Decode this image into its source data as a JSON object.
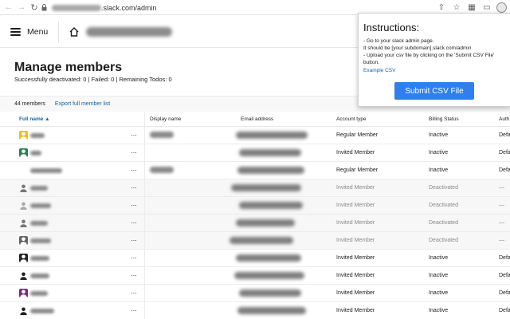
{
  "browser": {
    "url_visible_suffix": ".slack.com/admin"
  },
  "header": {
    "menu_label": "Menu"
  },
  "page": {
    "title": "Manage members",
    "stats": "Successfully deactivated: 0 | Failed: 0 | Remaining Todos: 0"
  },
  "members_bar": {
    "count": "44 members",
    "export_label": "Export full member list"
  },
  "table": {
    "headers": {
      "full_name": "Full name ▲",
      "display_name": "Display name",
      "email": "Email address",
      "account_type": "Account type",
      "billing": "Billing Status",
      "auth": "Auth"
    },
    "rows": [
      {
        "account_type": "Regular Member",
        "billing": "Inactive",
        "auth": "Defa",
        "deactivated": false
      },
      {
        "account_type": "Invited Member",
        "billing": "Inactive",
        "auth": "Defa",
        "deactivated": false
      },
      {
        "account_type": "Regular Member",
        "billing": "Inactive",
        "auth": "Defa",
        "deactivated": false
      },
      {
        "account_type": "Invited Member",
        "billing": "Deactivated",
        "auth": "—",
        "deactivated": true
      },
      {
        "account_type": "Invited Member",
        "billing": "Deactivated",
        "auth": "—",
        "deactivated": true
      },
      {
        "account_type": "Invited Member",
        "billing": "Deactivated",
        "auth": "—",
        "deactivated": true
      },
      {
        "account_type": "Invited Member",
        "billing": "Deactivated",
        "auth": "—",
        "deactivated": true
      },
      {
        "account_type": "Invited Member",
        "billing": "Inactive",
        "auth": "Defa",
        "deactivated": false
      },
      {
        "account_type": "Invited Member",
        "billing": "Inactive",
        "auth": "Defa",
        "deactivated": false
      },
      {
        "account_type": "Invited Member",
        "billing": "Inactive",
        "auth": "Defa",
        "deactivated": false
      },
      {
        "account_type": "Invited Member",
        "billing": "Inactive",
        "auth": "Defa",
        "deactivated": false
      }
    ]
  },
  "popup": {
    "title": "Instructions:",
    "lines": [
      "- Go to your slack admin page.",
      "It should be [your subdomain].slack.com/admin",
      "- Upload your csv file by clicking on the 'Submit CSV File'",
      "button."
    ],
    "example_link": "Example CSV",
    "submit_label": "Submit CSV File"
  },
  "colors": {
    "link": "#1264a3",
    "submit_button": "#2f7ff0"
  }
}
